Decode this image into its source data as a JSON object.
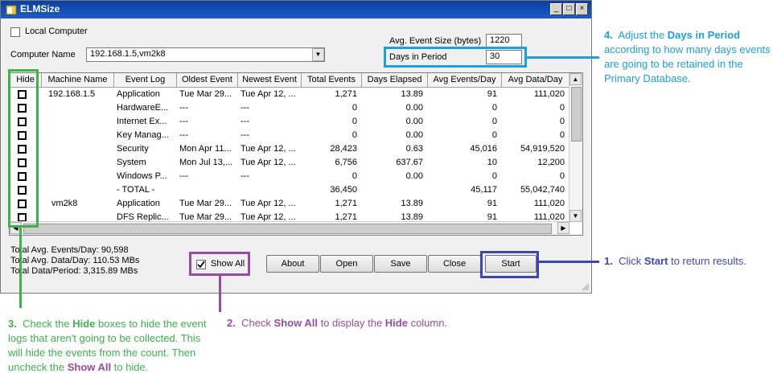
{
  "window": {
    "title": "ELMSize"
  },
  "local_computer": {
    "label": "Local Computer",
    "checked": false
  },
  "computer_name": {
    "label": "Computer Name",
    "value": "192.168.1.5,vm2k8"
  },
  "avg_event_size": {
    "label": "Avg. Event Size (bytes)",
    "value": "1220"
  },
  "days_in_period": {
    "label": "Days in Period",
    "value": "30"
  },
  "grid": {
    "columns": [
      "Hide",
      "Machine Name",
      "Event Log",
      "Oldest Event",
      "Newest Event",
      "Total Events",
      "Days Elapsed",
      "Avg Events/Day",
      "Avg Data/Day"
    ],
    "rows": [
      {
        "machine": "192.168.1.5",
        "log": "Application",
        "oldest": "Tue Mar 29...",
        "newest": "Tue Apr 12, ...",
        "total": "1,271",
        "days": "13.89",
        "avg_events": "91",
        "avg_data": "111,020"
      },
      {
        "machine": "",
        "log": "HardwareE...",
        "oldest": "---",
        "newest": "---",
        "total": "0",
        "days": "0.00",
        "avg_events": "0",
        "avg_data": "0"
      },
      {
        "machine": "",
        "log": "Internet Ex...",
        "oldest": "---",
        "newest": "---",
        "total": "0",
        "days": "0.00",
        "avg_events": "0",
        "avg_data": "0"
      },
      {
        "machine": "",
        "log": "Key Manag...",
        "oldest": "---",
        "newest": "---",
        "total": "0",
        "days": "0.00",
        "avg_events": "0",
        "avg_data": "0"
      },
      {
        "machine": "",
        "log": "Security",
        "oldest": "Mon Apr 11...",
        "newest": "Tue Apr 12, ...",
        "total": "28,423",
        "days": "0.63",
        "avg_events": "45,016",
        "avg_data": "54,919,520"
      },
      {
        "machine": "",
        "log": "System",
        "oldest": "Mon Jul 13,...",
        "newest": "Tue Apr 12, ...",
        "total": "6,756",
        "days": "637.67",
        "avg_events": "10",
        "avg_data": "12,200"
      },
      {
        "machine": "",
        "log": "Windows P...",
        "oldest": "---",
        "newest": "---",
        "total": "0",
        "days": "0.00",
        "avg_events": "0",
        "avg_data": "0"
      },
      {
        "machine": "",
        "log": "- TOTAL -",
        "oldest": "",
        "newest": "",
        "total": "36,450",
        "days": "",
        "avg_events": "45,117",
        "avg_data": "55,042,740"
      },
      {
        "machine": "vm2k8",
        "log": "Application",
        "oldest": "Tue Mar 29...",
        "newest": "Tue Apr 12, ...",
        "total": "1,271",
        "days": "13.89",
        "avg_events": "91",
        "avg_data": "111,020"
      },
      {
        "machine": "",
        "log": "DFS Replic...",
        "oldest": "Tue Mar 29...",
        "newest": "Tue Apr 12, ...",
        "total": "1,271",
        "days": "13.89",
        "avg_events": "91",
        "avg_data": "111,020"
      }
    ]
  },
  "totals": {
    "avg_events": "Total Avg. Events/Day: 90,598",
    "avg_data": "Total Avg. Data/Day: 110.53 MBs",
    "data_period": "Total Data/Period: 3,315.89 MBs"
  },
  "show_all": {
    "label": "Show All",
    "checked": true
  },
  "buttons": {
    "about": "About",
    "open": "Open",
    "save": "Save",
    "close": "Close",
    "start": "Start"
  },
  "annotations": {
    "a1": {
      "num": "1.",
      "pre": "Click ",
      "bold": "Start",
      "post": " to return results."
    },
    "a2": {
      "num": "2.",
      "pre": "Check ",
      "bold1": "Show All",
      "mid": " to display the ",
      "bold2": "Hide",
      "post": " column."
    },
    "a3": {
      "num": "3.",
      "pre": "Check the ",
      "bold1": "Hide",
      "mid": " boxes to hide the event logs that aren't going to be collected.  This will hide the events from the count.  Then uncheck the ",
      "bold2": "Show All",
      "post": " to hide."
    },
    "a4": {
      "num": "4.",
      "pre": "Adjust the ",
      "bold": "Days in Period",
      "post": " according to how many days events are going to be retained in the Primary Database."
    }
  },
  "colors": {
    "blue_annotation": "#3c46b4",
    "purple_annotation": "#9b4aa4",
    "green_annotation": "#3db24a",
    "cyan_annotation": "#1aa0e0"
  }
}
